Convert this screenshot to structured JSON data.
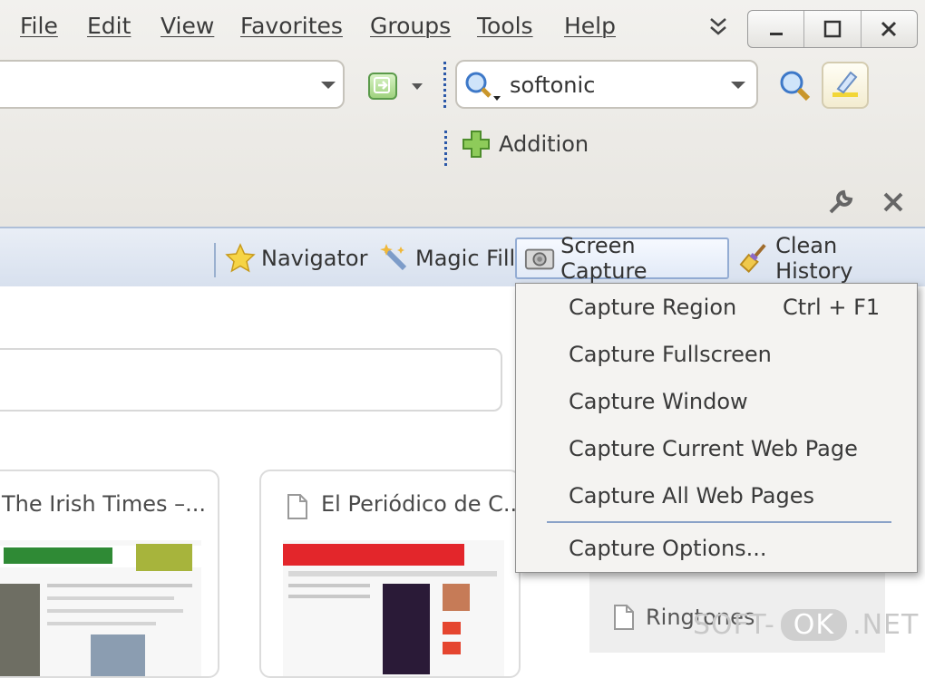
{
  "menu": {
    "items": [
      "File",
      "Edit",
      "View",
      "Favorites",
      "Groups",
      "Tools",
      "Help"
    ]
  },
  "window_controls": {
    "minimize": "minimize-icon",
    "maximize": "maximize-icon",
    "close": "close-icon"
  },
  "search": {
    "value": "softonic"
  },
  "addition": {
    "label": "Addition"
  },
  "toolbar": {
    "navigator": "Navigator",
    "magic_fill": "Magic Fill",
    "screen_capture": "Screen Capture",
    "clean_history": "Clean History"
  },
  "screen_capture_menu": {
    "items": [
      {
        "label": "Capture Region",
        "shortcut": "Ctrl + F1"
      },
      {
        "label": "Capture Fullscreen"
      },
      {
        "label": "Capture Window"
      },
      {
        "label": "Capture Current Web Page"
      },
      {
        "label": "Capture All Web Pages"
      },
      {
        "label": "Capture Options..."
      }
    ]
  },
  "speed_dial": {
    "cards": [
      {
        "title": "The Irish Times –..."
      },
      {
        "title": "El Periódico de C..."
      }
    ],
    "side_item": "Ringtones"
  },
  "watermark": {
    "left": "SOFT-",
    "mid": "OK",
    "right": ".NET"
  },
  "colors": {
    "toolbar_bg": "#dfe6f2",
    "accent_border": "#93acd3",
    "menu_separator": "#8aa2c8"
  }
}
